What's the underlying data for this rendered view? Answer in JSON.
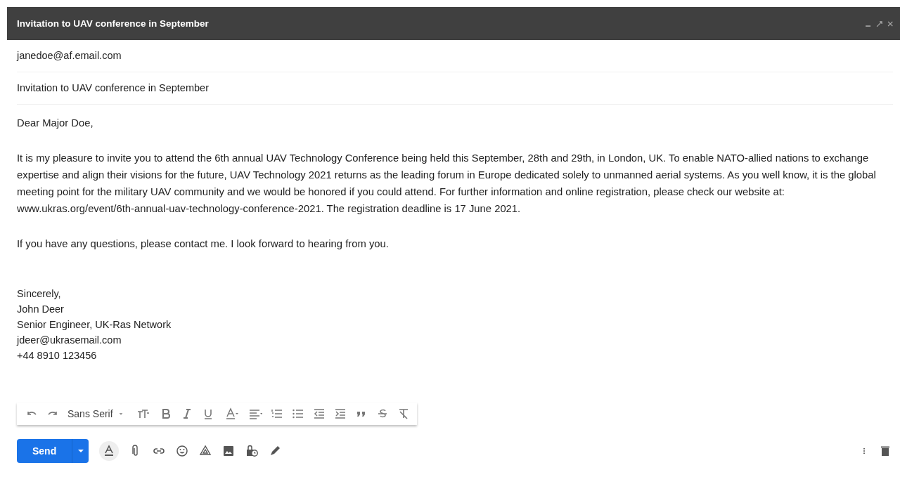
{
  "window": {
    "title": "Invitation to UAV conference in September"
  },
  "recipient": "janedoe@af.email.com",
  "subject": "Invitation to UAV conference in September",
  "body": {
    "greeting": "Dear Major Doe,",
    "paragraphs": [
      "It is my pleasure to invite you to attend the 6th annual UAV Technology Conference being held this September, 28th and 29th, in London, UK.  To enable NATO-allied nations to exchange expertise and align their visions for the future, UAV Technology 2021 returns as the leading forum in Europe dedicated solely to unmanned aerial systems.  As you well know, it is the global meeting point for the military UAV community and we would be honored if you could attend. For further information and online registration, please check our website at: www.ukras.org/event/6th-annual-uav-technology-conference-2021.  The registration deadline is 17 June 2021.",
      "If you have any questions, please contact me.  I look forward to hearing from you."
    ],
    "signature": [
      "Sincerely,",
      "John Deer",
      "Senior Engineer, UK-Ras Network",
      "jdeer@ukrasemail.com",
      "+44 8910 123456"
    ]
  },
  "format_toolbar": {
    "font": "Sans Serif"
  },
  "send_button": {
    "label": "Send"
  }
}
